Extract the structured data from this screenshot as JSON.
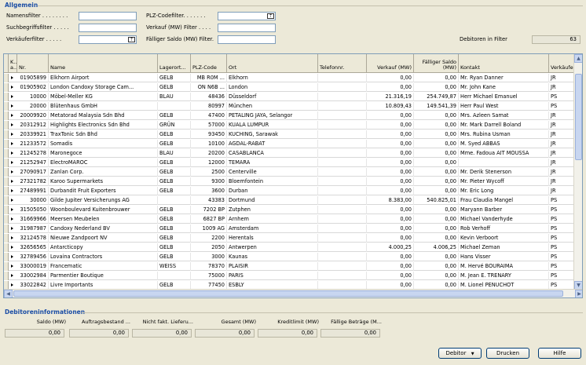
{
  "general": {
    "title": "Allgemein",
    "filters": [
      {
        "label": "Namensfilter . . . . . . . .",
        "value": ""
      },
      {
        "label": "Suchbegriffsfilter . . . . .",
        "value": ""
      },
      {
        "label": "Verkäuferfilter . . . . .",
        "value": ""
      },
      {
        "label": "PLZ-Codefilter. . . . . . .",
        "value": ""
      },
      {
        "label": "Verkauf (MW) Filter . . . .",
        "value": ""
      },
      {
        "label": "Fälliger Saldo (MW) Filter.",
        "value": ""
      }
    ],
    "customers_in_filter_label": "Debitoren in Filter",
    "customers_in_filter_value": "63"
  },
  "table": {
    "columns": [
      "K... a...",
      "Nr.",
      "Name",
      "Lagerort...",
      "PLZ-Code",
      "Ort",
      "Telefonnr.",
      "Verkauf (MW)",
      "Fälliger Saldo (MW)",
      "Kontakt",
      "Verkäufe"
    ],
    "rows": [
      [
        "",
        "01905899",
        "Elkhorn Airport",
        "GELB",
        "MB R0M ...",
        "Elkhorn",
        "",
        "0,00",
        "0,00",
        "Mr. Ryan Danner",
        "JR"
      ],
      [
        "",
        "01905902",
        "London Candoxy Storage Cam...",
        "GELB",
        "ON N6B ...",
        "London",
        "",
        "0,00",
        "0,00",
        "Mr. John Kane",
        "JR"
      ],
      [
        "",
        "10000",
        "Möbel-Meller KG",
        "BLAU",
        "48436",
        "Düsseldorf",
        "",
        "21.316,19",
        "254.749,87",
        "Herr Michael Emanuel",
        "PS"
      ],
      [
        "",
        "20000",
        "Blütenhaus GmbH",
        "",
        "80997",
        "München",
        "",
        "10.809,43",
        "149.541,39",
        "Herr Paul West",
        "PS"
      ],
      [
        "",
        "20009920",
        "Metatorad Malaysia Sdn Bhd",
        "GELB",
        "47400",
        "PETALING JAYA, Selangor",
        "",
        "0,00",
        "0,00",
        "Mrs. Azleen Samat",
        "JR"
      ],
      [
        "",
        "20312912",
        "Highlights Electronics Sdn Bhd",
        "GRÜN",
        "57000",
        "KUALA LUMPUR",
        "",
        "0,00",
        "0,00",
        "Mr. Mark Darrell Boland",
        "JR"
      ],
      [
        "",
        "20339921",
        "TraxTonic Sdn Bhd",
        "GELB",
        "93450",
        "KUCHING, Sarawak",
        "",
        "0,00",
        "0,00",
        "Mrs. Rubina Usman",
        "JR"
      ],
      [
        "",
        "21233572",
        "Somadis",
        "GELB",
        "10100",
        "AGDAL-RABAT",
        "",
        "0,00",
        "0,00",
        "M. Syed ABBAS",
        "JR"
      ],
      [
        "",
        "21245278",
        "Maronegoce",
        "BLAU",
        "20200",
        "CASABLANCA",
        "",
        "0,00",
        "0,00",
        "Mme. Fadoua AIT MOUSSA",
        "JR"
      ],
      [
        "",
        "21252947",
        "ElectroMAROC",
        "GELB",
        "12000",
        "TEMARA",
        "",
        "0,00",
        "0,00",
        "",
        "JR"
      ],
      [
        "",
        "27090917",
        "Zanlan Corp.",
        "GELB",
        "2500",
        "Centerville",
        "",
        "0,00",
        "0,00",
        "Mr. Derik Stenerson",
        "JR"
      ],
      [
        "",
        "27321782",
        "Karoo Supermarkets",
        "GELB",
        "9300",
        "Bloemfontein",
        "",
        "0,00",
        "0,00",
        "Mr. Pieter Wycoff",
        "JR"
      ],
      [
        "",
        "27489991",
        "Durbandit Fruit Exporters",
        "GELB",
        "3600",
        "Durban",
        "",
        "0,00",
        "0,00",
        "Mr. Eric Long",
        "JR"
      ],
      [
        "",
        "30000",
        "Gilde Jupiter Versicherungs AG",
        "",
        "43383",
        "Dortmund",
        "",
        "8.383,00",
        "540.825,01",
        "Frau Claudia Mangel",
        "PS"
      ],
      [
        "",
        "31505050",
        "Woonboulevard Kuitenbrouwer",
        "GELB",
        "7202 BP",
        "Zutphen",
        "",
        "0,00",
        "0,00",
        "Maryann Barber",
        "PS"
      ],
      [
        "",
        "31669966",
        "Meersen Meubelen",
        "GELB",
        "6827 BP",
        "Arnhem",
        "",
        "0,00",
        "0,00",
        "Michael Vanderhyde",
        "PS"
      ],
      [
        "",
        "31987987",
        "Candoxy Nederland BV",
        "GELB",
        "1009 AG",
        "Amsterdam",
        "",
        "0,00",
        "0,00",
        "Rob Verhoff",
        "PS"
      ],
      [
        "",
        "32124578",
        "Nieuwe Zandpoort NV",
        "GELB",
        "2200",
        "Herentals",
        "",
        "0,00",
        "0,00",
        "Kevin Verboort",
        "PS"
      ],
      [
        "",
        "32656565",
        "Antarcticopy",
        "GELB",
        "2050",
        "Antwerpen",
        "",
        "4.000,25",
        "4.006,25",
        "Michael Zeman",
        "PS"
      ],
      [
        "",
        "32789456",
        "Lovaina Contractors",
        "GELB",
        "3000",
        "Kaunas",
        "",
        "0,00",
        "0,00",
        "Hans Visser",
        "PS"
      ],
      [
        "",
        "33000019",
        "Francematic",
        "WEISS",
        "78370",
        "PLAISIR",
        "",
        "0,00",
        "0,00",
        "M. Hervé BOURAIMA",
        "PS"
      ],
      [
        "",
        "33002984",
        "Parmentier Boutique",
        "",
        "75000",
        "PARIS",
        "",
        "0,00",
        "0,00",
        "M. Jean E. TRENARY",
        "PS"
      ],
      [
        "",
        "33022842",
        "Livre Importants",
        "GELB",
        "77450",
        "ESBLY",
        "",
        "0,00",
        "0,00",
        "M. Lionel PENUCHOT",
        "PS"
      ]
    ]
  },
  "info": {
    "title": "Debitoreninformationen",
    "labels": [
      "Saldo (MW)",
      "Auftragsbestand ...",
      "Nicht fakt. Lieferu...",
      "Gesamt (MW)",
      "Kreditlimit (MW)",
      "Fällige Beträge (M..."
    ],
    "values": [
      "0,00",
      "0,00",
      "0,00",
      "0,00",
      "0,00",
      "0,00"
    ]
  },
  "buttons": {
    "debtor": "Debitor",
    "print": "Drucken",
    "help": "Hilfe"
  }
}
